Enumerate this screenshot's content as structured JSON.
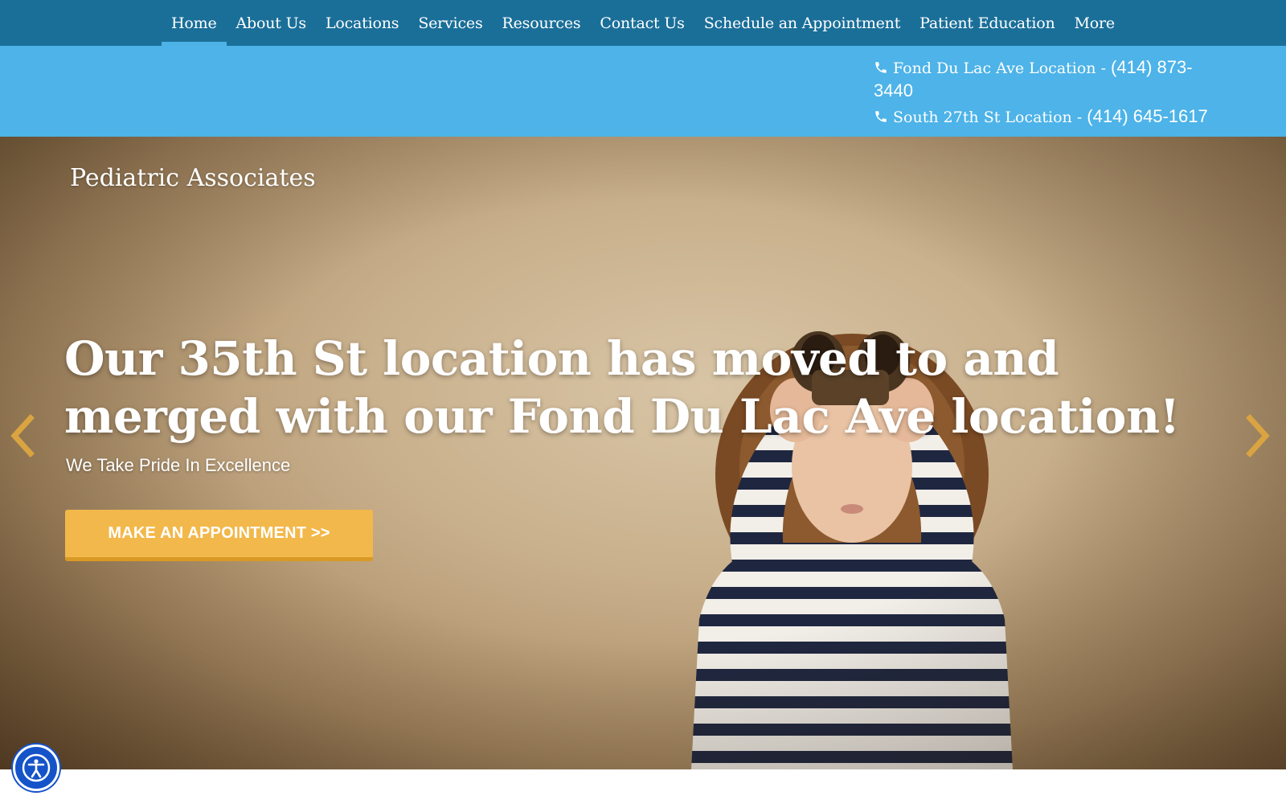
{
  "nav": {
    "items": [
      {
        "label": "Home",
        "active": true
      },
      {
        "label": "About Us"
      },
      {
        "label": "Locations"
      },
      {
        "label": "Services"
      },
      {
        "label": "Resources"
      },
      {
        "label": "Contact Us"
      },
      {
        "label": "Schedule an Appointment"
      },
      {
        "label": "Patient Education"
      },
      {
        "label": "More"
      }
    ]
  },
  "contact": {
    "locations": [
      {
        "name": "Fond Du Lac Ave Location - ",
        "phone": "(414) 873-3440",
        "icon": "phone-icon"
      },
      {
        "name": "South 27th St Location - ",
        "phone": "(414) 645-1617",
        "icon": "phone-icon"
      }
    ]
  },
  "hero": {
    "brand": "Pediatric Associates",
    "headline": "Our 35th St location has moved to and merged with our Fond Du Lac Ave location!",
    "tagline": "We Take Pride In Excellence",
    "cta_label": "MAKE AN APPOINTMENT >>",
    "prev_icon": "chevron-left-icon",
    "next_icon": "chevron-right-icon"
  },
  "accessibility": {
    "icon": "accessibility-icon"
  },
  "colors": {
    "nav_bg": "#1a6f99",
    "infobar_bg": "#4db3e8",
    "cta_bg": "#f2b84b",
    "arrow": "#d9a441",
    "a11y_bg": "#1553c9"
  }
}
